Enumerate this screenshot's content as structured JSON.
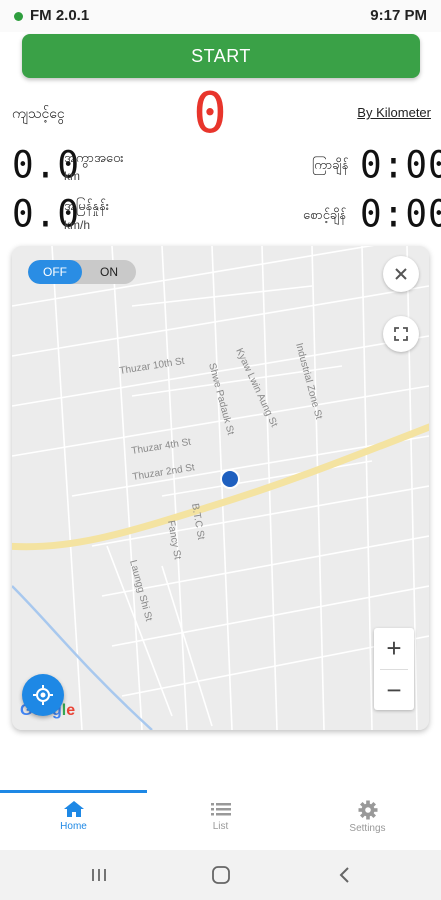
{
  "status": {
    "app_name": "FM 2.0.1",
    "time": "9:17 PM",
    "indicator_color": "#2e9e3e"
  },
  "start_button": {
    "label": "START",
    "color": "#3aa147"
  },
  "fare": {
    "label": "ကျသင့်ငွေ",
    "value": "0",
    "value_color": "#e8352c"
  },
  "unit_link": "By Kilometer",
  "distance": {
    "value": "0.0",
    "label": "အကွာအဝေး",
    "unit": "km"
  },
  "speed": {
    "value": "0.0",
    "label": "အမြန်နှုန်း",
    "unit": "km/h"
  },
  "elapsed": {
    "label": "ကြာချိန်",
    "value": "0:00"
  },
  "waiting": {
    "label": "စောင့်ချိန်",
    "value": "0:00"
  },
  "map": {
    "toggle_off": "OFF",
    "toggle_on": "ON",
    "close_icon": "close-icon",
    "fullscreen_icon": "fullscreen-icon",
    "zoom_in": "+",
    "zoom_out": "−",
    "locate_icon": "my-location-icon",
    "attribution": "Google",
    "streets": [
      "Thuzar 10th St",
      "Shwe Padauk St",
      "Kyaw Lwin Aung St",
      "Industrial Zone St",
      "Thuzar 4th St",
      "Thuzar 2nd St",
      "B.T.C St",
      "Fancy St",
      "Laungg Shi St"
    ],
    "accent": "#1e88e5"
  },
  "tabs": [
    {
      "label": "Home",
      "icon": "home-icon",
      "active": true
    },
    {
      "label": "List",
      "icon": "list-icon",
      "active": false
    },
    {
      "label": "Settings",
      "icon": "gear-icon",
      "active": false
    }
  ],
  "system_nav": {
    "recents_icon": "recents-icon",
    "home_icon": "home-circle-icon",
    "back_icon": "back-icon"
  }
}
